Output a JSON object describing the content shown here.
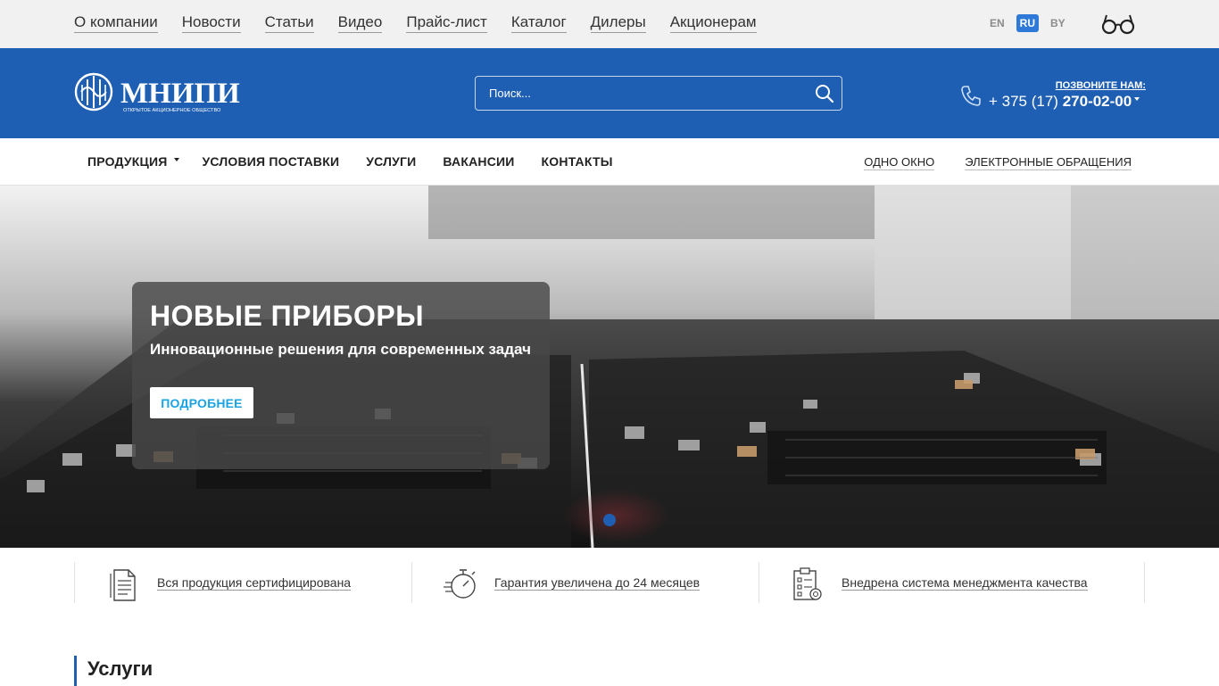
{
  "topbar": {
    "nav": [
      "О компании",
      "Новости",
      "Статьи",
      "Видео",
      "Прайс-лист",
      "Каталог",
      "Дилеры",
      "Акционерам"
    ],
    "languages": [
      "EN",
      "RU",
      "BY"
    ],
    "active_language": "RU",
    "accessibility_icon": "glasses-icon"
  },
  "header": {
    "logo_name": "МНИПИ",
    "logo_tagline": "ОТКРЫТОЕ АКЦИОНЕРНОЕ ОБЩЕСТВО",
    "search_placeholder": "Поиск...",
    "call_label": "ПОЗВОНИТЕ НАМ:",
    "phone_prefix": "+ 375 (17) ",
    "phone_number": "270-02-00",
    "bg_color": "#1e5fb3"
  },
  "mainnav": {
    "items": [
      "ПРОДУКЦИЯ",
      "УСЛОВИЯ ПОСТАВКИ",
      "УСЛУГИ",
      "ВАКАНСИИ",
      "КОНТАКТЫ"
    ],
    "right_items": [
      "ОДНО ОКНО",
      "ЭЛЕКТРОННЫЕ ОБРАЩЕНИЯ"
    ]
  },
  "hero": {
    "title": "НОВЫЕ ПРИБОРЫ",
    "subtitle": "Инновационные решения для современных задач",
    "button_label": "ПОДРОБНЕЕ",
    "button_color": "#1aa3e3"
  },
  "features": [
    {
      "icon": "certificate-document-icon",
      "label": "Вся продукция сертифицирована"
    },
    {
      "icon": "stopwatch-icon",
      "label": "Гарантия увеличена до 24 месяцев"
    },
    {
      "icon": "checklist-icon",
      "label": "Внедрена система менеджмента качества"
    }
  ],
  "section": {
    "title": "Услуги"
  }
}
